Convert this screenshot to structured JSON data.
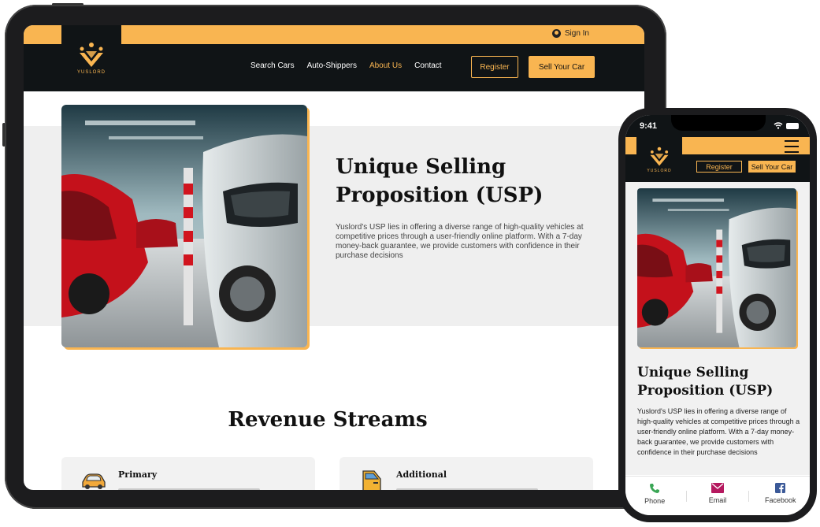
{
  "brand": {
    "logo_text": "YUSLORD",
    "accent": "#f9b551",
    "dark": "#101416"
  },
  "header": {
    "signin_label": "Sign In",
    "nav": [
      "Search Cars",
      "Auto-Shippers",
      "About Us",
      "Contact"
    ],
    "active_nav": "About Us",
    "register_label": "Register",
    "sell_label": "Sell Your Car"
  },
  "usp": {
    "title": "Unique Selling Proposition (USP)",
    "text": "Yuslord's USP lies in offering a diverse range of high-quality vehicles at competitive prices through a user-friendly online platform. With a 7-day money-back guarantee, we provide customers with confidence in their purchase decisions"
  },
  "revenue": {
    "title": "Revenue Streams",
    "cards": [
      {
        "title": "Primary",
        "icon": "car-icon"
      },
      {
        "title": "Additional",
        "icon": "car-door-icon"
      }
    ]
  },
  "phone": {
    "time": "9:41",
    "footer": [
      {
        "label": "Phone",
        "icon": "phone-icon",
        "color": "#3aa655"
      },
      {
        "label": "Email",
        "icon": "email-icon",
        "color": "#b5195f"
      },
      {
        "label": "Facebook",
        "icon": "facebook-icon",
        "color": "#3b5998"
      }
    ]
  }
}
